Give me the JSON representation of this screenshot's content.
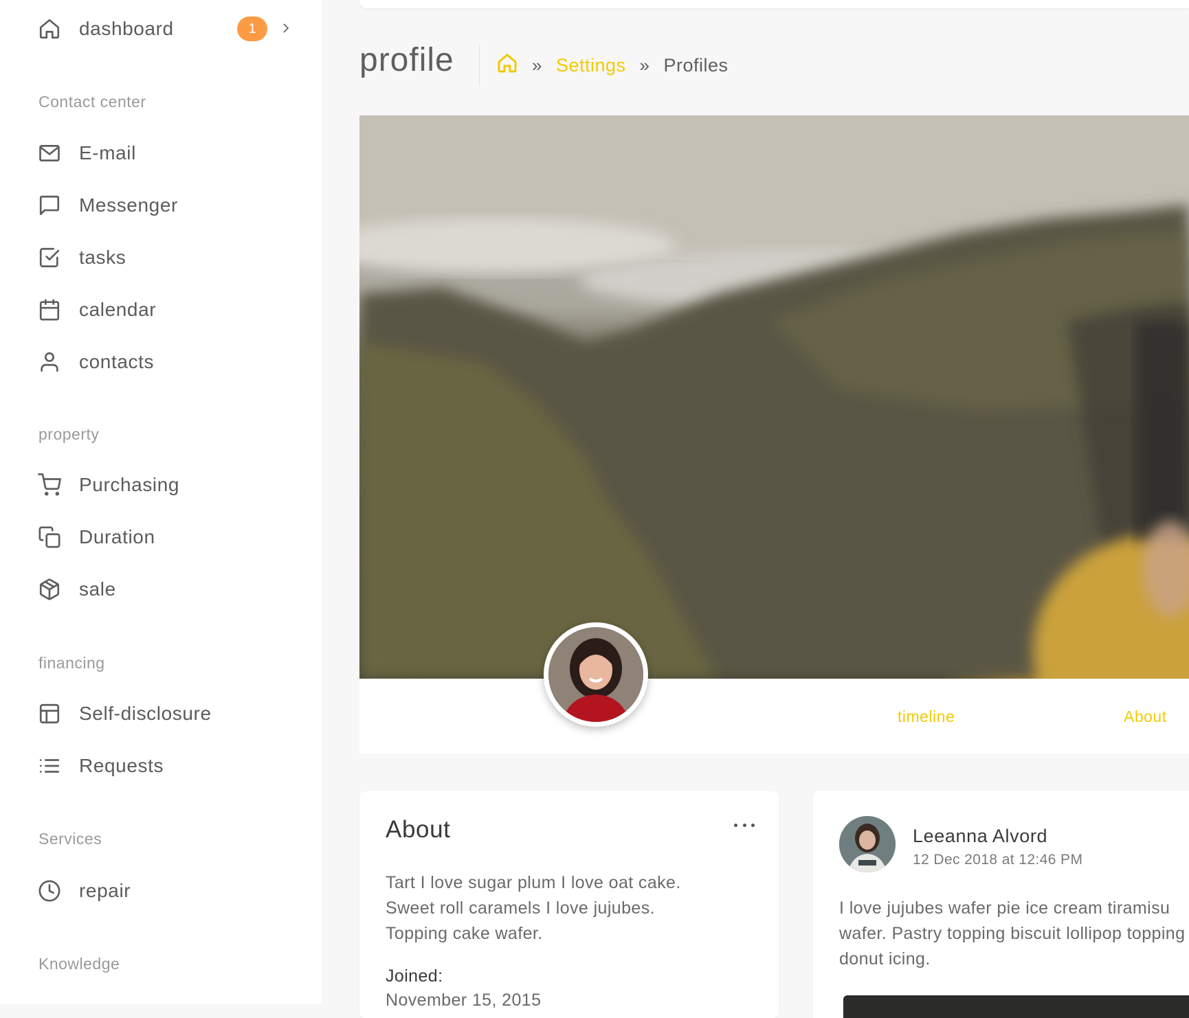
{
  "sidebar": {
    "dashboard": {
      "label": "dashboard",
      "badge": "1"
    },
    "sections": {
      "contact_center": "Contact center",
      "property": "property",
      "financing": "financing",
      "services": "Services",
      "knowledge": "Knowledge"
    },
    "items": {
      "email": "E-mail",
      "messenger": "Messenger",
      "tasks": "tasks",
      "calendar": "calendar",
      "contacts": "contacts",
      "purchasing": "Purchasing",
      "duration": "Duration",
      "sale": "sale",
      "self_disclosure": "Self-disclosure",
      "requests": "Requests",
      "repair": "repair"
    }
  },
  "header": {
    "title": "profile",
    "breadcrumb": {
      "link": "Settings",
      "current": "Profiles",
      "separator": "»"
    }
  },
  "profile_tabs": {
    "timeline": "timeline",
    "about": "About"
  },
  "about_card": {
    "title": "About",
    "lines": [
      "Tart I love sugar plum I love oat cake.",
      "Sweet roll caramels I love jujubes.",
      "Topping cake wafer."
    ],
    "joined_label": "Joined:",
    "joined_value": "November 15, 2015"
  },
  "post_card": {
    "author": "Leeanna Alvord",
    "date": "12 Dec 2018 at 12:46 PM",
    "lines": [
      "I love jujubes wafer pie ice cream tiramisu",
      "wafer. Pastry topping biscuit lollipop topping",
      "donut icing."
    ]
  },
  "colors": {
    "accent": "#f0cc00",
    "badge": "#fd9b44",
    "text": "#5e5e5e"
  },
  "icons": {
    "dashboard": "home-icon",
    "email": "mail-icon",
    "messenger": "message-square-icon",
    "tasks": "check-square-icon",
    "calendar": "calendar-icon",
    "contacts": "user-icon",
    "purchasing": "shopping-cart-icon",
    "duration": "copy-icon",
    "sale": "box-icon",
    "self_disclosure": "layout-icon",
    "requests": "list-icon",
    "repair": "clock-icon"
  }
}
